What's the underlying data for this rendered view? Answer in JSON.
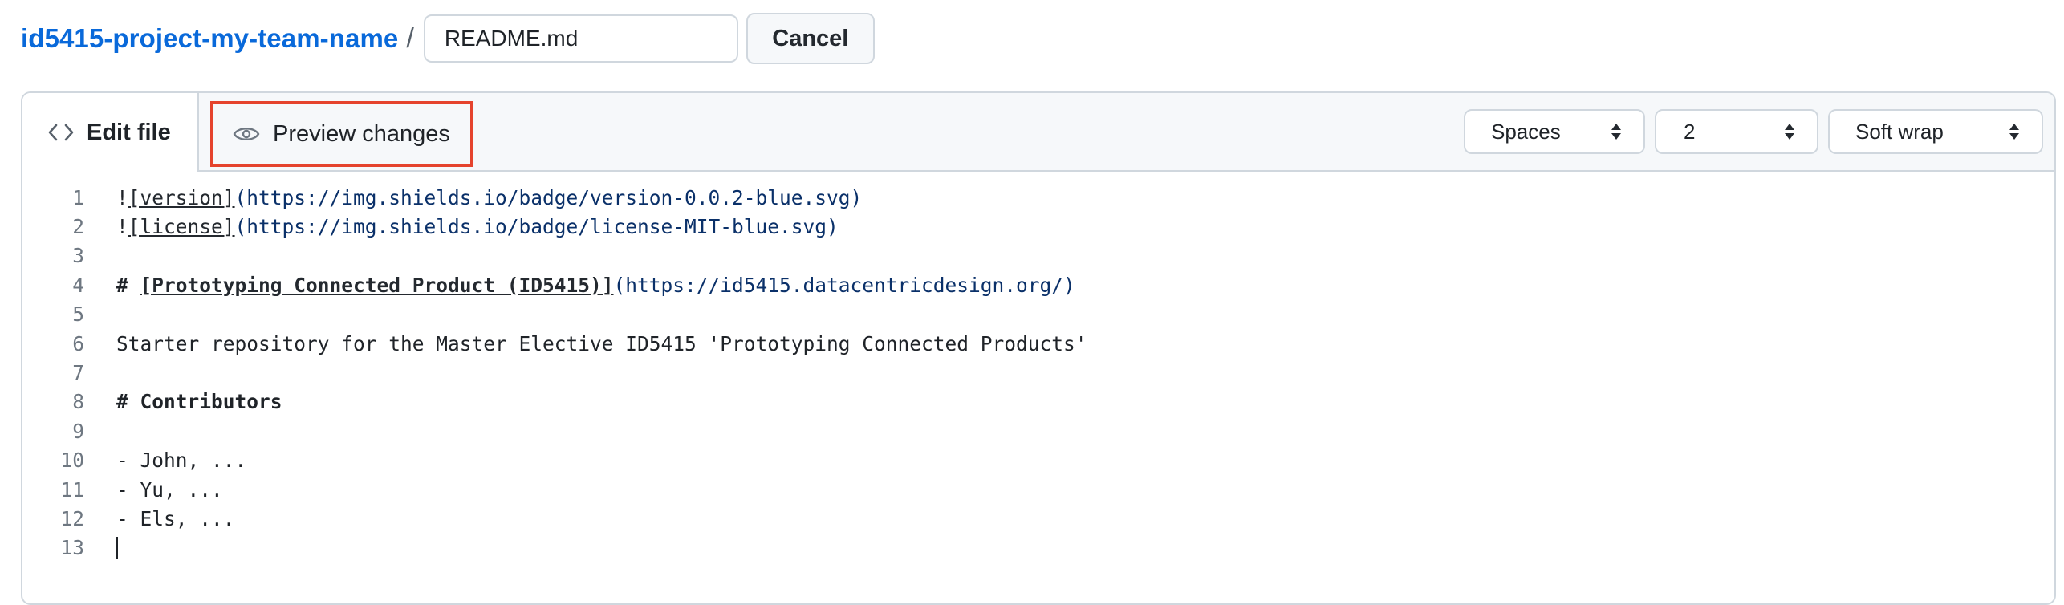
{
  "header": {
    "repo_name": "id5415-project-my-team-name",
    "separator": "/",
    "filename_value": "README.md",
    "cancel_label": "Cancel"
  },
  "tabs": {
    "edit": {
      "label": "Edit file",
      "icon": "code-icon"
    },
    "preview": {
      "label": "Preview changes",
      "icon": "eye-icon",
      "highlight_color": "#e5432d"
    }
  },
  "options": {
    "indent_mode": "Spaces",
    "indent_size": "2",
    "wrap_mode": "Soft wrap"
  },
  "code_lines": [
    {
      "n": "1",
      "parts": [
        [
          "txt",
          "!"
        ],
        [
          "link",
          "[version]"
        ],
        [
          "url",
          "(https://img.shields.io/badge/version-0.0.2-blue.svg)"
        ]
      ]
    },
    {
      "n": "2",
      "parts": [
        [
          "txt",
          "!"
        ],
        [
          "link",
          "[license]"
        ],
        [
          "url",
          "(https://img.shields.io/badge/license-MIT-blue.svg)"
        ]
      ]
    },
    {
      "n": "3",
      "parts": []
    },
    {
      "n": "4",
      "parts": [
        [
          "bold",
          "# "
        ],
        [
          "boldlink",
          "[Prototyping Connected Product (ID5415)]"
        ],
        [
          "url",
          "(https://id5415.datacentricdesign.org/)"
        ]
      ]
    },
    {
      "n": "5",
      "parts": []
    },
    {
      "n": "6",
      "parts": [
        [
          "txt",
          "Starter repository for the Master Elective ID5415 'Prototyping Connected Products'"
        ]
      ]
    },
    {
      "n": "7",
      "parts": []
    },
    {
      "n": "8",
      "parts": [
        [
          "bold",
          "# Contributors"
        ]
      ]
    },
    {
      "n": "9",
      "parts": []
    },
    {
      "n": "10",
      "parts": [
        [
          "txt",
          "- John, ..."
        ]
      ]
    },
    {
      "n": "11",
      "parts": [
        [
          "txt",
          "- Yu, ..."
        ]
      ]
    },
    {
      "n": "12",
      "parts": [
        [
          "txt",
          "- Els, ..."
        ]
      ]
    },
    {
      "n": "13",
      "parts": [
        [
          "caret",
          ""
        ]
      ]
    }
  ],
  "colors": {
    "link": "#0969da",
    "url": "#0a3069",
    "highlight": "#e5432d"
  }
}
